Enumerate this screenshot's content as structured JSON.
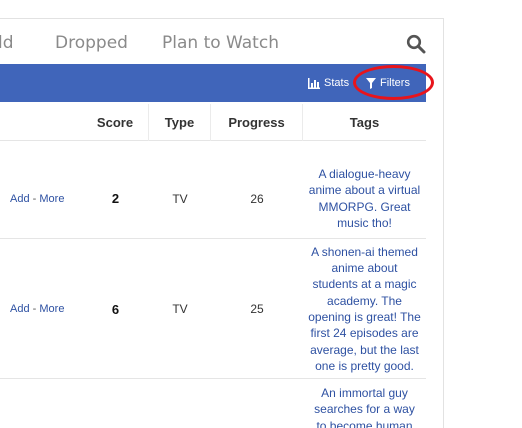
{
  "status_tabs": [
    "ld",
    "Dropped",
    "Plan to Watch"
  ],
  "toolbar": {
    "stats_label": "Stats",
    "filters_label": "Filters"
  },
  "icons": {
    "search": "search-icon",
    "stats": "bar-chart-icon",
    "filters": "funnel-icon"
  },
  "colors": {
    "toolbar_bg": "#4065ba",
    "highlight": "#e8141b",
    "link": "#2e51a2"
  },
  "table": {
    "headers": {
      "score": "Score",
      "type": "Type",
      "progress": "Progress",
      "tags": "Tags"
    },
    "rows": [
      {
        "add": "Add",
        "sep": "-",
        "more": "More",
        "score": "2",
        "type": "TV",
        "progress": "26",
        "tags": [
          "A dialogue-heavy",
          "anime about a virtual",
          "MMORPG. Great",
          "music tho!"
        ]
      },
      {
        "add": "Add",
        "sep": "-",
        "more": "More",
        "score": "6",
        "type": "TV",
        "progress": "25",
        "tags": [
          "A shonen-ai themed",
          "anime about",
          "students at a magic",
          "academy. The",
          "opening is great! The",
          "first 24 episodes are",
          "average, but the last",
          "one is pretty good."
        ]
      },
      {
        "add": "",
        "sep": "",
        "more": "",
        "score": "",
        "type": "",
        "progress": "",
        "tags": [
          "An immortal guy",
          "searches for a way",
          "to become human"
        ]
      }
    ]
  }
}
